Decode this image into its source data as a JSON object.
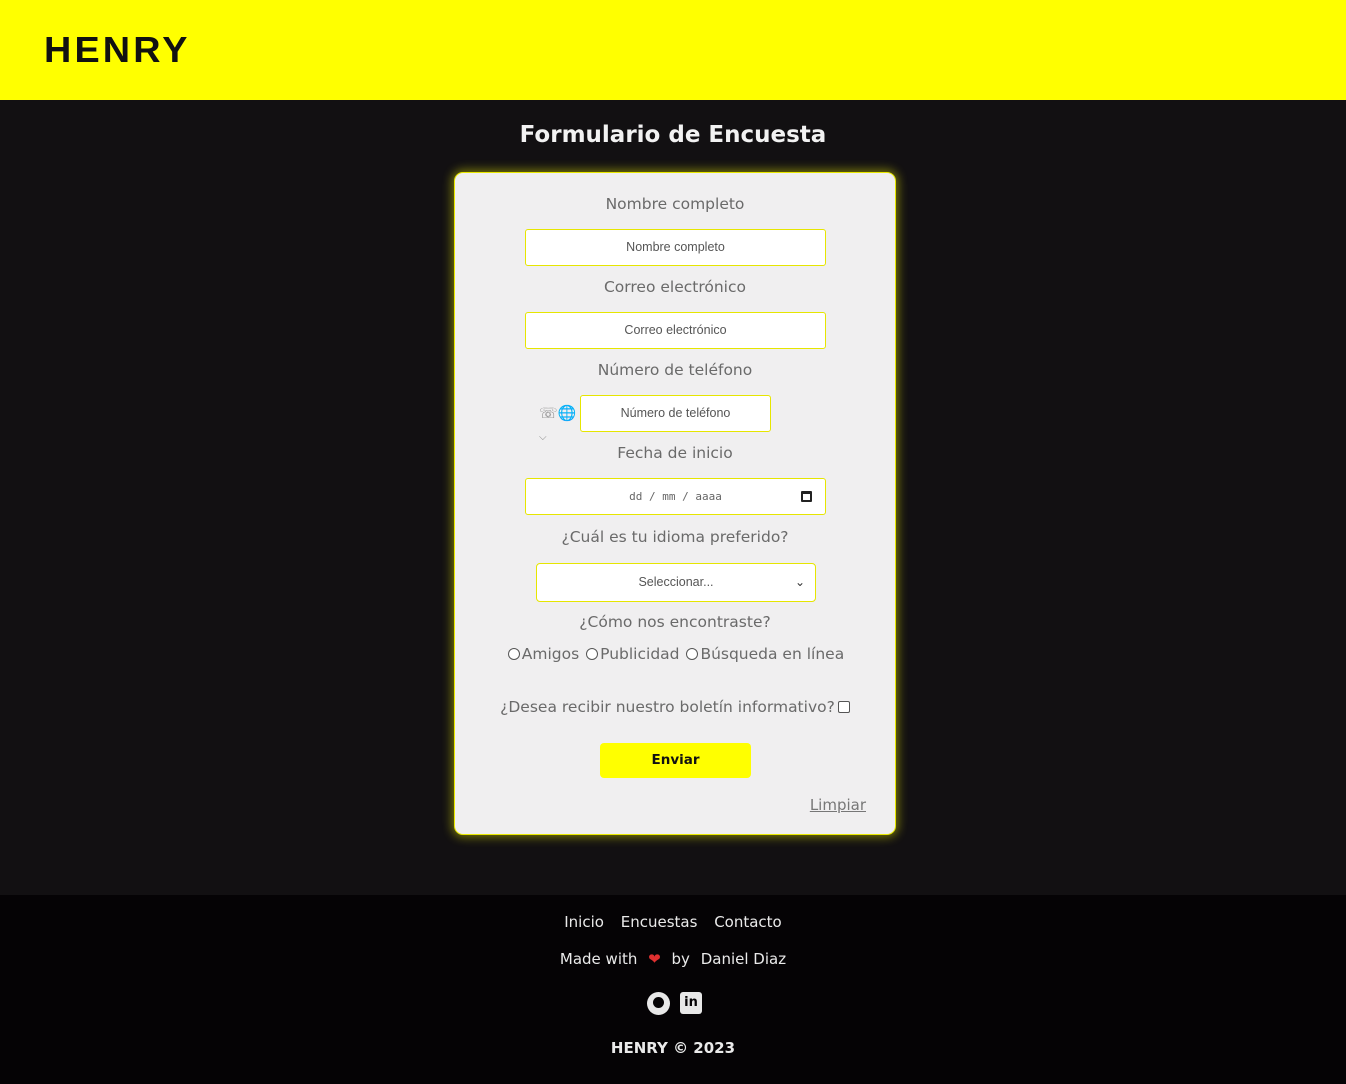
{
  "header": {
    "logo": "HENRY"
  },
  "form": {
    "title": "Formulario de Encuesta",
    "name_label": "Nombre completo",
    "name_placeholder": "Nombre completo",
    "email_label": "Correo electrónico",
    "email_placeholder": "Correo electrónico",
    "phone_label": "Número de teléfono",
    "phone_placeholder": "Número de teléfono",
    "date_label": "Fecha de inicio",
    "date_placeholder": "dd / mm / aaaa",
    "language_label": "¿Cuál es tu idioma preferido?",
    "language_selected": "Seleccionar...",
    "source_label": "¿Cómo nos encontraste?",
    "source_options": [
      "Amigos",
      "Publicidad",
      "Búsqueda en línea"
    ],
    "newsletter_label": "¿Desea recibir nuestro boletín informativo?",
    "submit_label": "Enviar",
    "clear_label": "Limpiar"
  },
  "footer": {
    "links": [
      "Inicio",
      "Encuestas",
      "Contacto"
    ],
    "made_with": "Made with",
    "by": "by",
    "author": "Daniel Diaz",
    "copyright": "HENRY © 2023",
    "icons": [
      "github-icon",
      "linkedin-icon"
    ]
  },
  "colors": {
    "accent": "#ffff00",
    "background": "#121012",
    "card": "#f0eff0"
  }
}
